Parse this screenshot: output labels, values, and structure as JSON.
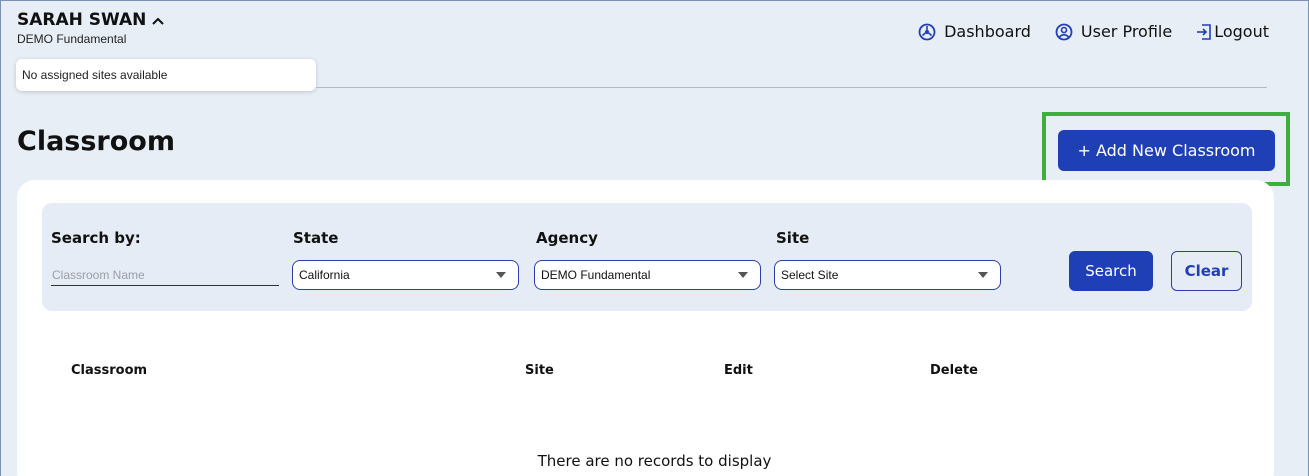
{
  "user": {
    "name": "SARAH SWAN",
    "org": "DEMO Fundamental",
    "sites_popup": "No assigned sites available"
  },
  "nav": {
    "dashboard": "Dashboard",
    "profile": "User Profile",
    "logout": "Logout"
  },
  "page": {
    "title": "Classroom",
    "add_button": "+ Add New Classroom"
  },
  "filters": {
    "search_by_label": "Search by:",
    "search_placeholder": "Classroom Name",
    "state_label": "State",
    "state_value": "California",
    "agency_label": "Agency",
    "agency_value": "DEMO Fundamental",
    "site_label": "Site",
    "site_value": "Select Site",
    "search_button": "Search",
    "clear_button": "Clear"
  },
  "table": {
    "columns": [
      "Classroom",
      "Site",
      "Edit",
      "Delete"
    ],
    "empty_message": "There are no records to display"
  },
  "colors": {
    "primary": "#1f3fb7",
    "highlight": "#3fae3f",
    "background": "#e8eef6"
  }
}
